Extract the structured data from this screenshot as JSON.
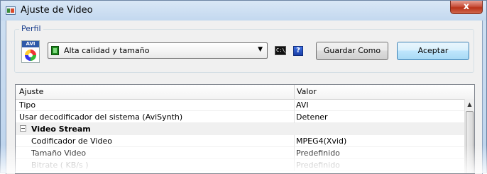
{
  "window": {
    "title": "Ajuste de Video",
    "close_label": "x"
  },
  "perfil": {
    "legend": "Perfil",
    "avi_tag": "AVI",
    "selected_profile": "Alta calidad y tamaño",
    "dropdown_arrow": "▼",
    "cmd_label": "C:\\_",
    "help_label": "?",
    "save_as_label": "Guardar Como",
    "accept_label": "Aceptar"
  },
  "grid": {
    "header": {
      "setting": "Ajuste",
      "value": "Valor"
    },
    "rows": [
      {
        "setting": "Tipo",
        "value": "AVI"
      },
      {
        "setting": "Usar decodificador del sistema (AviSynth)",
        "value": "Detener"
      },
      {
        "setting": "Video Stream",
        "value": ""
      },
      {
        "setting": "Codificador de Video",
        "value": "MPEG4(Xvid)"
      },
      {
        "setting": "Tamaño Video",
        "value": "Predefinido"
      },
      {
        "setting": "Bitrate ( KB/s )",
        "value": "Predefinido"
      }
    ],
    "scroll_up": "▲"
  }
}
